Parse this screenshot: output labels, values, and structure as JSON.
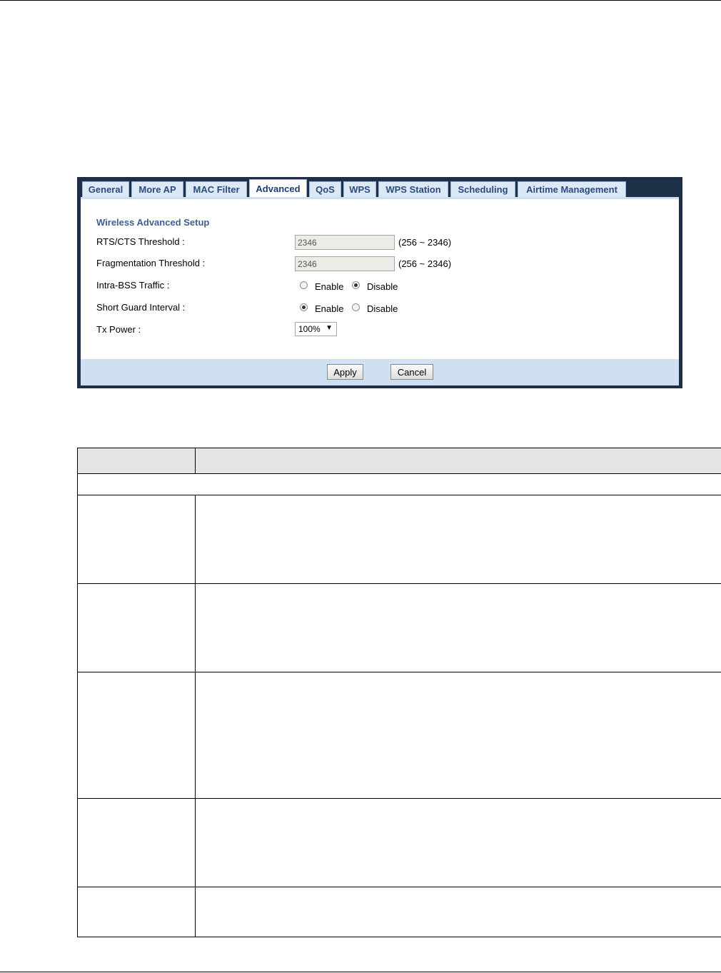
{
  "tabs": [
    "General",
    "More AP",
    "MAC Filter",
    "Advanced",
    "QoS",
    "WPS",
    "WPS Station",
    "Scheduling",
    "Airtime Management"
  ],
  "active_tab": "Advanced",
  "section_title": "Wireless Advanced Setup",
  "fields": {
    "rts": {
      "label": "RTS/CTS Threshold :",
      "value": "2346",
      "range": "(256 ~ 2346)"
    },
    "frag": {
      "label": "Fragmentation Threshold :",
      "value": "2346",
      "range": "(256 ~ 2346)"
    },
    "intra_bss": {
      "label": "Intra-BSS Traffic :",
      "enable": "Enable",
      "disable": "Disable",
      "selected": "Disable"
    },
    "sgi": {
      "label": "Short Guard Interval :",
      "enable": "Enable",
      "disable": "Disable",
      "selected": "Enable"
    },
    "tx_power": {
      "label": "Tx Power :",
      "value": "100%"
    }
  },
  "buttons": {
    "apply": "Apply",
    "cancel": "Cancel"
  },
  "table_rows": 7
}
